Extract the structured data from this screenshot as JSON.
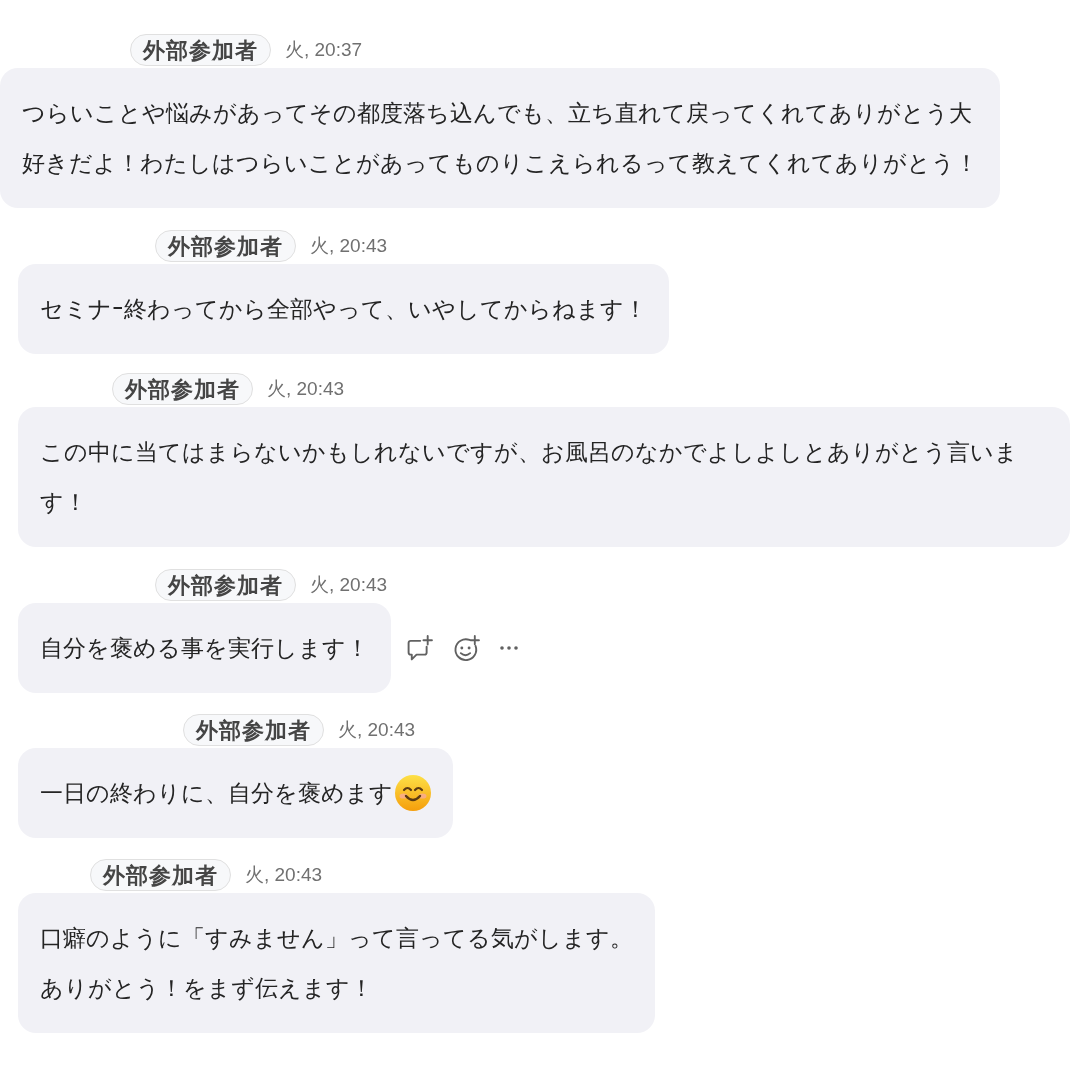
{
  "messages": [
    {
      "badge": "外部参加者",
      "time": "火, 20:37",
      "lines": [
        "つらいことや悩みがあってその都度落ち込んでも、立ち直れて戻ってくれてありがとう大",
        "好きだよ！わたしはつらいことがあってものりこえられるって教えてくれてありがとう！"
      ],
      "emoji": false,
      "actions_visible": false
    },
    {
      "badge": "外部参加者",
      "time": "火, 20:43",
      "lines": [
        "セミナｰ終わってから全部やって、いやしてからねます！"
      ],
      "emoji": false,
      "actions_visible": false
    },
    {
      "badge": "外部参加者",
      "time": "火, 20:43",
      "lines": [
        "この中に当てはまらないかもしれないですが、お風呂のなかでよしよしとありがとう言いま",
        "す！"
      ],
      "emoji": false,
      "actions_visible": false
    },
    {
      "badge": "外部参加者",
      "time": "火, 20:43",
      "lines": [
        "自分を褒める事を実行します！"
      ],
      "emoji": false,
      "actions_visible": true
    },
    {
      "badge": "外部参加者",
      "time": "火, 20:43",
      "lines": [
        "一日の終わりに、自分を褒めます"
      ],
      "emoji": true,
      "actions_visible": false
    },
    {
      "badge": "外部参加者",
      "time": "火, 20:43",
      "lines": [
        "口癖のように「すみません」って言ってる気がします。",
        "ありがとう！をまず伝えます！"
      ],
      "emoji": false,
      "actions_visible": false
    }
  ]
}
